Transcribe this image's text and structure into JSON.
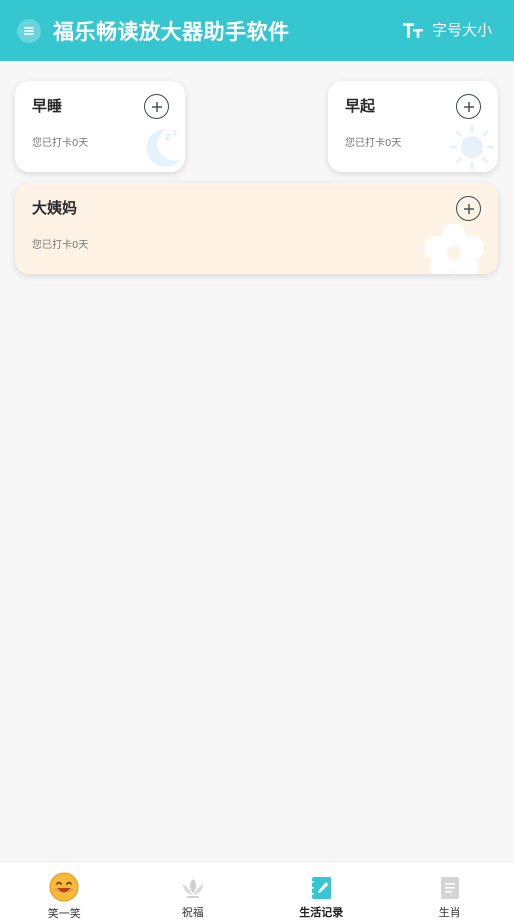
{
  "header": {
    "title": "福乐畅读放大器助手软件",
    "menu_icon": "menu-icon",
    "font_size_icon": "font-size-icon",
    "font_size_label": "字号大小",
    "bg_color": "#36c6cf"
  },
  "cards": [
    {
      "id": "sleep",
      "title": "早睡",
      "subtitle": "您已打卡0天",
      "icon": "moon-icon",
      "add_icon": "plus-icon",
      "bg": "#ffffff"
    },
    {
      "id": "wake",
      "title": "早起",
      "subtitle": "您已打卡0天",
      "icon": "sun-icon",
      "add_icon": "plus-icon",
      "bg": "#ffffff"
    },
    {
      "id": "period",
      "title": "大姨妈",
      "subtitle": "您已打卡0天",
      "icon": "flower-icon",
      "add_icon": "plus-icon",
      "bg": "#fff3e6"
    }
  ],
  "bottom_nav": {
    "items": [
      {
        "label": "笑一笑",
        "icon": "smile-emoji-icon",
        "active": false
      },
      {
        "label": "祝福",
        "icon": "lotus-icon",
        "active": false
      },
      {
        "label": "生活记录",
        "icon": "notebook-pen-icon",
        "active": true
      },
      {
        "label": "生肖",
        "icon": "document-icon",
        "active": false
      }
    ]
  }
}
